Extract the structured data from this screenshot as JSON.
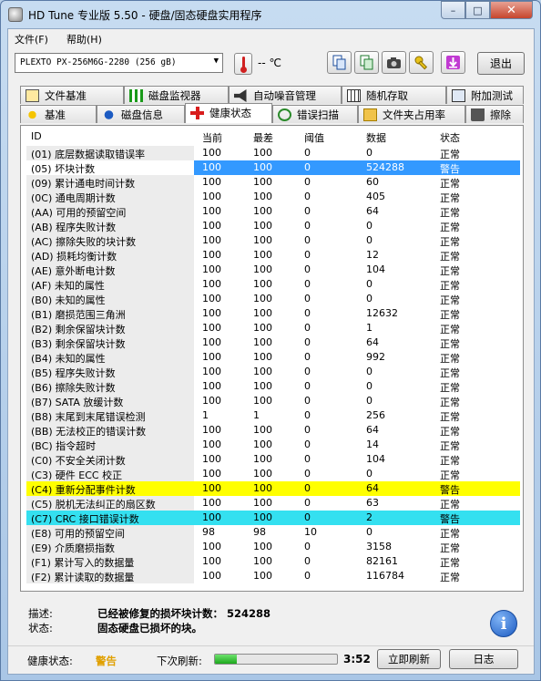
{
  "window": {
    "title": "HD Tune 专业版 5.50 - 硬盘/固态硬盘实用程序",
    "min": "–",
    "max": "□",
    "close": "✕"
  },
  "menu": {
    "file": "文件(F)",
    "help": "帮助(H)"
  },
  "toolbar": {
    "drive": "PLEXTO PX-256M6G-2280 (256 gB)",
    "temperature": "-- ℃",
    "exit": "退出"
  },
  "tabs_top": [
    "文件基准",
    "磁盘监视器",
    "自动噪音管理",
    "随机存取",
    "附加测试"
  ],
  "tabs_bottom": [
    "基准",
    "磁盘信息",
    "健康状态",
    "错误扫描",
    "文件夹占用率",
    "擦除"
  ],
  "columns": {
    "id": "ID",
    "current": "当前",
    "worst": "最差",
    "threshold": "阈值",
    "data": "数据",
    "status": "状态"
  },
  "rows": [
    {
      "id": "(01) 底层数据读取错误率",
      "current": "100",
      "worst": "100",
      "threshold": "0",
      "data": "0",
      "status": "正常"
    },
    {
      "id": "(05) 坏块计数",
      "current": "100",
      "worst": "100",
      "threshold": "0",
      "data": "524288",
      "status": "警告"
    },
    {
      "id": "(09) 累计通电时间计数",
      "current": "100",
      "worst": "100",
      "threshold": "0",
      "data": "60",
      "status": "正常"
    },
    {
      "id": "(0C) 通电周期计数",
      "current": "100",
      "worst": "100",
      "threshold": "0",
      "data": "405",
      "status": "正常"
    },
    {
      "id": "(AA) 可用的预留空间",
      "current": "100",
      "worst": "100",
      "threshold": "0",
      "data": "64",
      "status": "正常"
    },
    {
      "id": "(AB) 程序失败计数",
      "current": "100",
      "worst": "100",
      "threshold": "0",
      "data": "0",
      "status": "正常"
    },
    {
      "id": "(AC) 擦除失败的块计数",
      "current": "100",
      "worst": "100",
      "threshold": "0",
      "data": "0",
      "status": "正常"
    },
    {
      "id": "(AD) 损耗均衡计数",
      "current": "100",
      "worst": "100",
      "threshold": "0",
      "data": "12",
      "status": "正常"
    },
    {
      "id": "(AE) 意外断电计数",
      "current": "100",
      "worst": "100",
      "threshold": "0",
      "data": "104",
      "status": "正常"
    },
    {
      "id": "(AF) 未知的属性",
      "current": "100",
      "worst": "100",
      "threshold": "0",
      "data": "0",
      "status": "正常"
    },
    {
      "id": "(B0) 未知的属性",
      "current": "100",
      "worst": "100",
      "threshold": "0",
      "data": "0",
      "status": "正常"
    },
    {
      "id": "(B1) 磨损范围三角洲",
      "current": "100",
      "worst": "100",
      "threshold": "0",
      "data": "12632",
      "status": "正常"
    },
    {
      "id": "(B2) 剩余保留块计数",
      "current": "100",
      "worst": "100",
      "threshold": "0",
      "data": "1",
      "status": "正常"
    },
    {
      "id": "(B3) 剩余保留块计数",
      "current": "100",
      "worst": "100",
      "threshold": "0",
      "data": "64",
      "status": "正常"
    },
    {
      "id": "(B4) 未知的属性",
      "current": "100",
      "worst": "100",
      "threshold": "0",
      "data": "992",
      "status": "正常"
    },
    {
      "id": "(B5) 程序失败计数",
      "current": "100",
      "worst": "100",
      "threshold": "0",
      "data": "0",
      "status": "正常"
    },
    {
      "id": "(B6) 擦除失败计数",
      "current": "100",
      "worst": "100",
      "threshold": "0",
      "data": "0",
      "status": "正常"
    },
    {
      "id": "(B7) SATA 放缓计数",
      "current": "100",
      "worst": "100",
      "threshold": "0",
      "data": "0",
      "status": "正常"
    },
    {
      "id": "(B8) 末尾到末尾错误检测",
      "current": "1",
      "worst": "1",
      "threshold": "0",
      "data": "256",
      "status": "正常"
    },
    {
      "id": "(BB) 无法校正的错误计数",
      "current": "100",
      "worst": "100",
      "threshold": "0",
      "data": "64",
      "status": "正常"
    },
    {
      "id": "(BC) 指令超时",
      "current": "100",
      "worst": "100",
      "threshold": "0",
      "data": "14",
      "status": "正常"
    },
    {
      "id": "(C0) 不安全关闭计数",
      "current": "100",
      "worst": "100",
      "threshold": "0",
      "data": "104",
      "status": "正常"
    },
    {
      "id": "(C3) 硬件 ECC 校正",
      "current": "100",
      "worst": "100",
      "threshold": "0",
      "data": "0",
      "status": "正常"
    },
    {
      "id": "(C4) 重新分配事件计数",
      "current": "100",
      "worst": "100",
      "threshold": "0",
      "data": "64",
      "status": "警告"
    },
    {
      "id": "(C5) 脱机无法纠正的扇区数",
      "current": "100",
      "worst": "100",
      "threshold": "0",
      "data": "63",
      "status": "正常"
    },
    {
      "id": "(C7) CRC 接口错误计数",
      "current": "100",
      "worst": "100",
      "threshold": "0",
      "data": "2",
      "status": "警告"
    },
    {
      "id": "(E8) 可用的预留空间",
      "current": "98",
      "worst": "98",
      "threshold": "10",
      "data": "0",
      "status": "正常"
    },
    {
      "id": "(E9) 介质磨损指数",
      "current": "100",
      "worst": "100",
      "threshold": "0",
      "data": "3158",
      "status": "正常"
    },
    {
      "id": "(F1) 累计写入的数据量",
      "current": "100",
      "worst": "100",
      "threshold": "0",
      "data": "82161",
      "status": "正常"
    },
    {
      "id": "(F2) 累计读取的数据量",
      "current": "100",
      "worst": "100",
      "threshold": "0",
      "data": "116784",
      "status": "正常"
    }
  ],
  "details": {
    "desc_label": "描述:",
    "desc_value": "已经被修复的损坏块计数：  524288",
    "state_label": "状态:",
    "state_value": "固态硬盘已损坏的块。"
  },
  "statusbar": {
    "health_label": "健康状态:",
    "health_value": "警告",
    "next_label": "下次刷新:",
    "progress": 0.18,
    "time": "3:52",
    "refresh": "立即刷新",
    "log": "日志"
  }
}
